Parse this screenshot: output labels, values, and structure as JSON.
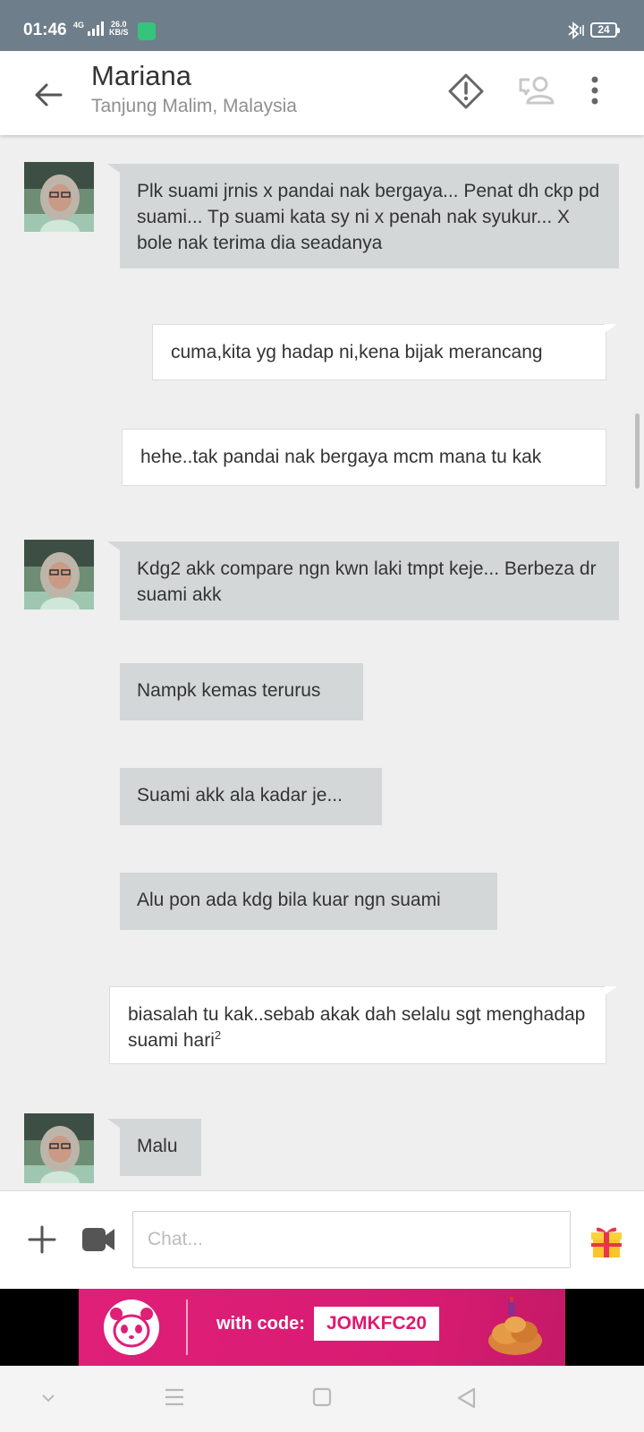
{
  "status_bar": {
    "time": "01:46",
    "network": "4G",
    "speed_value": "26.0",
    "speed_unit": "KB/S",
    "battery": "24"
  },
  "header": {
    "contact_name": "Mariana",
    "location": "Tanjung Malim, Malaysia",
    "icons": [
      "back-arrow-icon",
      "report-icon",
      "contact-icon",
      "more-icon"
    ]
  },
  "messages": [
    {
      "from": "contact",
      "text": "Plk suami jrnis x pandai nak bergaya... Penat dh ckp pd suami... Tp suami kata sy ni x penah nak syukur... X bole nak terima dia seadanya"
    },
    {
      "from": "me",
      "text": "cuma,kita yg hadap ni,kena bijak merancang"
    },
    {
      "from": "me",
      "text": "hehe..tak pandai nak bergaya mcm mana tu kak"
    },
    {
      "from": "contact",
      "text": "Kdg2 akk compare ngn kwn laki tmpt keje... Berbeza dr suami akk"
    },
    {
      "from": "contact",
      "text": "Nampk kemas terurus"
    },
    {
      "from": "contact",
      "text": "Suami akk ala kadar je..."
    },
    {
      "from": "contact",
      "text": "Alu pon ada kdg bila kuar ngn suami"
    },
    {
      "from": "me",
      "text": "biasalah tu kak..sebab akak dah selalu sgt menghadap suami hari",
      "superscript": "2"
    },
    {
      "from": "contact",
      "text": "Malu"
    }
  ],
  "composer": {
    "placeholder": "Chat...",
    "icons": [
      "add-icon",
      "video-camera-icon",
      "gift-icon"
    ]
  },
  "ad": {
    "text": "with code:",
    "code": "JOMKFC20"
  },
  "nav": {
    "icons": [
      "chevron-down-icon",
      "menu-icon",
      "home-icon",
      "back-triangle-icon"
    ]
  }
}
